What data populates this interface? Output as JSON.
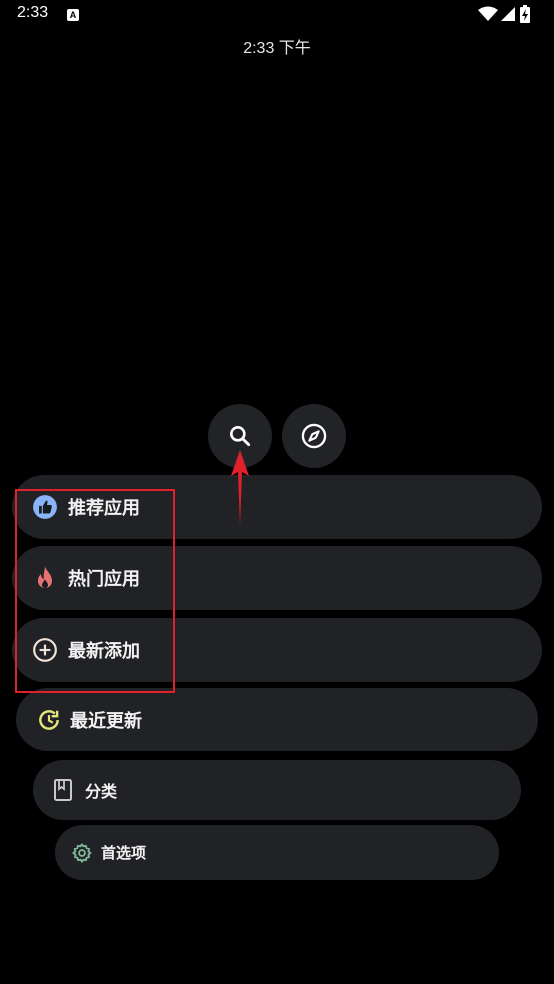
{
  "status_bar": {
    "time": "2:33",
    "notification_icon": "a-icon",
    "icons": [
      "wifi-icon",
      "signal-icon",
      "battery-charging-icon"
    ]
  },
  "clock": {
    "text": "2:33 下午"
  },
  "top_buttons": [
    {
      "icon": "search-icon"
    },
    {
      "icon": "compass-icon"
    }
  ],
  "menu": {
    "items": [
      {
        "label": "推荐应用",
        "icon": "thumbs-up-icon",
        "icon_color": "#8ab4f8"
      },
      {
        "label": "热门应用",
        "icon": "fire-icon",
        "icon_color": "#e57373"
      },
      {
        "label": "最新添加",
        "icon": "add-circle-icon",
        "icon_color": "#f2e3d8"
      },
      {
        "label": "最近更新",
        "icon": "update-icon",
        "icon_color": "#e6e67a"
      },
      {
        "label": "分类",
        "icon": "book-icon",
        "icon_color": "#c8c8c8"
      },
      {
        "label": "首选项",
        "icon": "gear-icon",
        "icon_color": "#7fb89a"
      }
    ]
  },
  "colors": {
    "background": "#000000",
    "pill": "#212225",
    "highlight": "#e0202a"
  }
}
